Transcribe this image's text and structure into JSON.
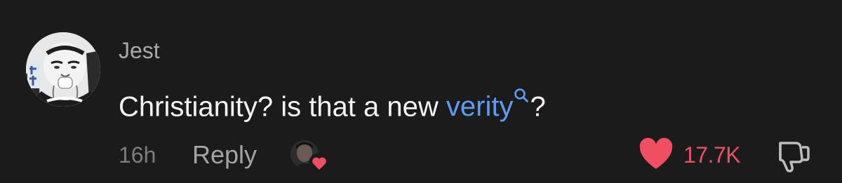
{
  "comment": {
    "username": "Jest",
    "text_before": "Christianity? is that a new ",
    "search_term": "verity",
    "text_after": "?",
    "time_ago": "16h",
    "reply_label": "Reply",
    "like_count": "17.7K",
    "icons": {
      "search": "search-icon",
      "heart": "heart-icon",
      "dislike": "thumbs-down-icon"
    }
  },
  "colors": {
    "background": "#1b1b1b",
    "link": "#5e9cf0",
    "like": "#ef4e63",
    "muted": "#a4a4a4"
  }
}
